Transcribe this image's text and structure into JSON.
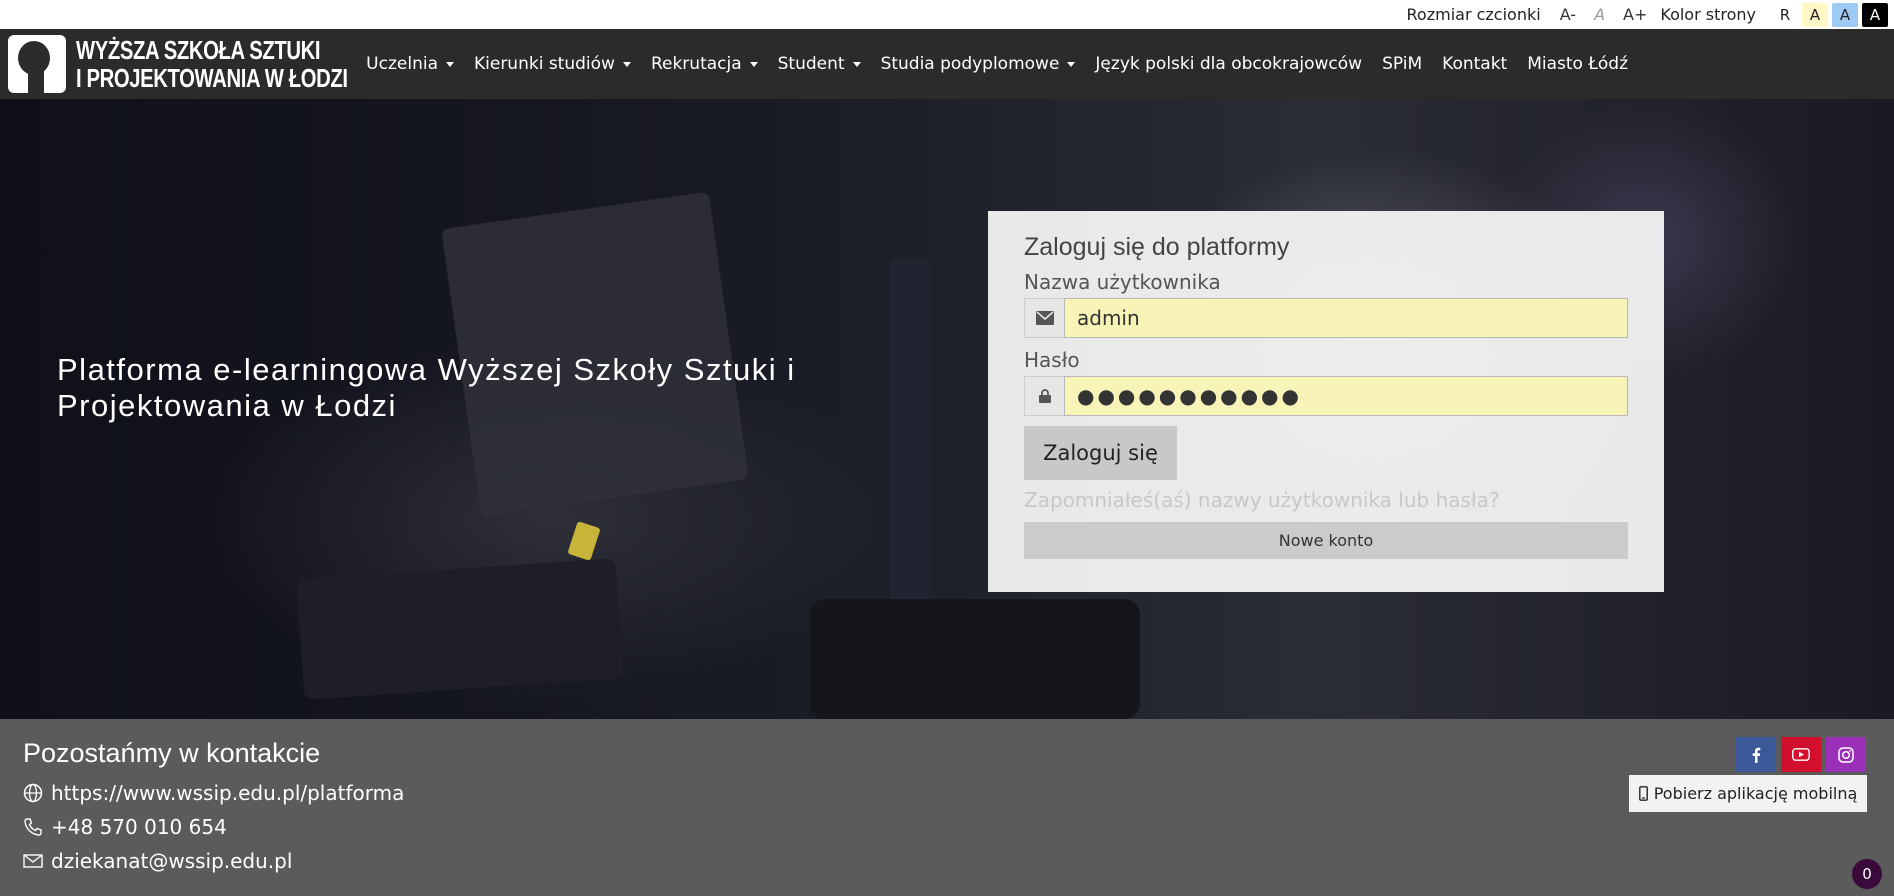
{
  "a11y": {
    "font_size_label": "Rozmiar czcionki",
    "font_decrease": "A-",
    "font_default": "A",
    "font_increase": "A+",
    "page_color_label": "Kolor strony",
    "color_reset": "R",
    "color_yellow": "A",
    "color_blue": "A",
    "color_black": "A"
  },
  "logo": {
    "line1": "WYŻSZA SZKOŁA SZTUKI",
    "line2": "I PROJEKTOWANIA W ŁODZI"
  },
  "nav": {
    "items": [
      {
        "label": "Uczelnia",
        "dropdown": true
      },
      {
        "label": "Kierunki studiów",
        "dropdown": true
      },
      {
        "label": "Rekrutacja",
        "dropdown": true
      },
      {
        "label": "Student",
        "dropdown": true
      },
      {
        "label": "Studia podyplomowe",
        "dropdown": true
      },
      {
        "label": "Język polski dla obcokrajowców",
        "dropdown": false
      },
      {
        "label": "SPiM",
        "dropdown": false
      },
      {
        "label": "Kontakt",
        "dropdown": false
      },
      {
        "label": "Miasto Łódź",
        "dropdown": false
      }
    ]
  },
  "hero": {
    "title": "Platforma e-learningowa Wyższej Szkoły Sztuki i Projektowania w Łodzi"
  },
  "login": {
    "title": "Zaloguj się do platformy",
    "username_label": "Nazwa użytkownika",
    "username_value": "admin",
    "password_label": "Hasło",
    "password_value": "●●●●●●●●●●●",
    "submit_label": "Zaloguj się",
    "forgot_label": "Zapomniałeś(aś) nazwy użytkownika lub hasła?",
    "new_account_label": "Nowe konto"
  },
  "footer": {
    "title": "Pozostańmy w kontakcie",
    "website": "https://www.wssip.edu.pl/platforma",
    "phone": "+48 570 010 654",
    "email": "dziekanat@wssip.edu.pl",
    "app_button_label": "Pobierz aplikację mobilną",
    "social": [
      {
        "name": "facebook-icon",
        "color": "#3b5998"
      },
      {
        "name": "youtube-icon",
        "color": "#d2102e"
      },
      {
        "name": "instagram-icon",
        "color": "#9b30b8"
      }
    ],
    "badge_count": "0"
  }
}
